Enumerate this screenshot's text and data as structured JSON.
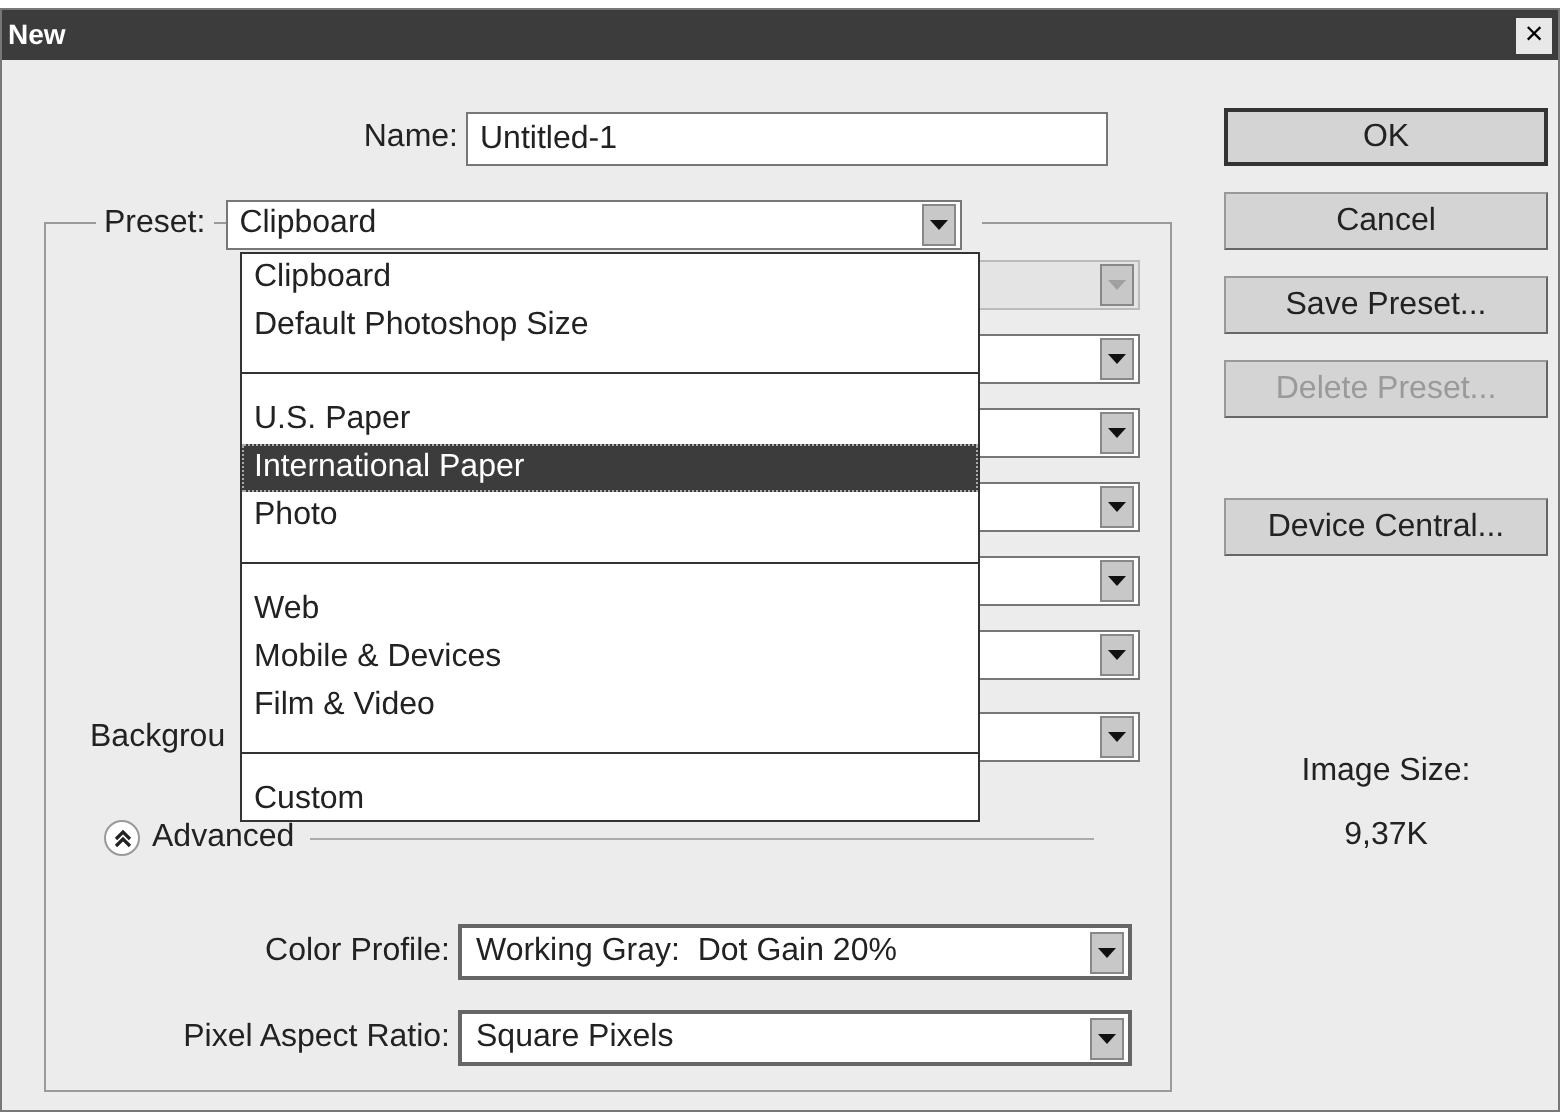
{
  "window": {
    "title": "New",
    "close": "×"
  },
  "name": {
    "label": "Name:",
    "value": "Untitled-1"
  },
  "preset": {
    "label": "Preset:",
    "value": "Clipboard"
  },
  "preset_menu": {
    "groups": [
      [
        {
          "label": "Clipboard",
          "selected": false
        },
        {
          "label": "Default Photoshop Size",
          "selected": false
        }
      ],
      [
        {
          "label": "U.S. Paper",
          "selected": false
        },
        {
          "label": "International Paper",
          "selected": true
        },
        {
          "label": "Photo",
          "selected": false
        }
      ],
      [
        {
          "label": "Web",
          "selected": false
        },
        {
          "label": "Mobile & Devices",
          "selected": false
        },
        {
          "label": "Film & Video",
          "selected": false
        }
      ],
      [
        {
          "label": "Custom",
          "selected": false
        }
      ]
    ]
  },
  "hidden_fields": [
    {
      "disabled": true
    },
    {
      "disabled": false
    },
    {
      "disabled": false
    },
    {
      "disabled": false
    },
    {
      "disabled": false
    },
    {
      "disabled": false
    },
    {
      "disabled": false,
      "label": "Backgrou"
    }
  ],
  "advanced": {
    "label": "Advanced",
    "expanded": true
  },
  "advanced_fields": [
    {
      "label": "Color Profile:",
      "value": "Working Gray:  Dot Gain 20%"
    },
    {
      "label": "Pixel Aspect Ratio:",
      "value": "Square Pixels"
    }
  ],
  "buttons": [
    {
      "label": "OK",
      "default": true,
      "disabled": false
    },
    {
      "label": "Cancel",
      "default": false,
      "disabled": false
    },
    {
      "label": "Save Preset...",
      "default": false,
      "disabled": false
    },
    {
      "label": "Delete Preset...",
      "default": false,
      "disabled": true
    },
    {
      "label": "Device Central...",
      "default": false,
      "disabled": false
    }
  ],
  "image_size": {
    "label": "Image Size:",
    "value": "9,37K"
  }
}
